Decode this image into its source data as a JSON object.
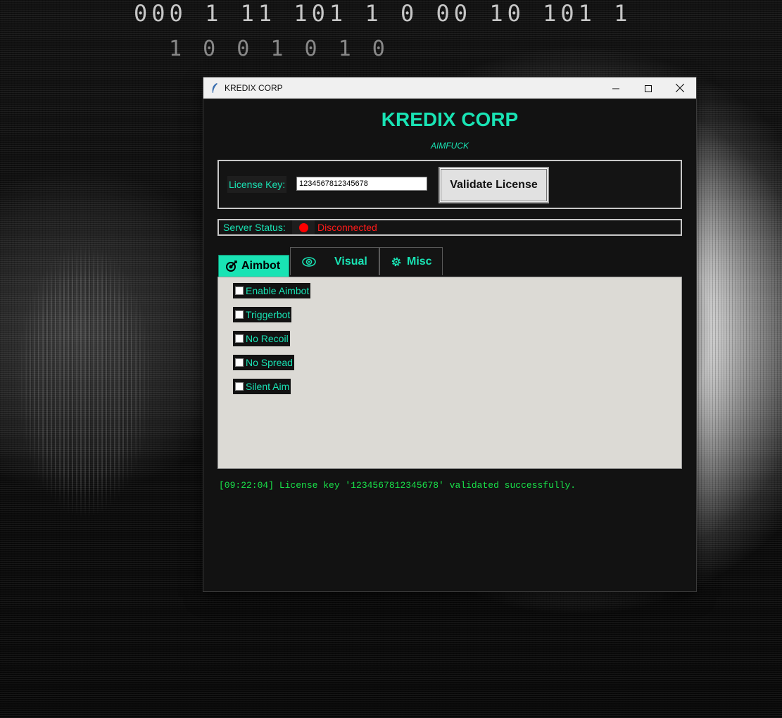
{
  "desktop": {
    "binary_rows": [
      "000 1 11  101  1  0 00 10 101   1",
      "1    0 0         1  0       1 0"
    ]
  },
  "window": {
    "title": "KREDIX CORP",
    "controls": {
      "minimize_icon": "minimize-icon",
      "maximize_icon": "maximize-icon",
      "close_icon": "close-icon"
    }
  },
  "header": {
    "title": "KREDIX CORP",
    "subtitle": "AIMFUCK"
  },
  "license": {
    "label": "License Key:",
    "value": "1234567812345678",
    "validate_label": "Validate License"
  },
  "server": {
    "label": "Server Status:",
    "status_text": "Disconnected",
    "status_color": "#ff0000"
  },
  "tabs": [
    {
      "label": "Aimbot",
      "icon": "target-icon",
      "active": true
    },
    {
      "label": "Visual",
      "icon": "eye-icon",
      "active": false
    },
    {
      "label": "Misc",
      "icon": "gear-icon",
      "active": false
    }
  ],
  "aimbot_options": [
    {
      "label": "Enable Aimbot",
      "checked": false
    },
    {
      "label": "Triggerbot",
      "checked": false
    },
    {
      "label": "No Recoil",
      "checked": false
    },
    {
      "label": "No Spread",
      "checked": false
    },
    {
      "label": "Silent Aim",
      "checked": false
    }
  ],
  "log": {
    "lines": [
      "[09:22:04] License key '1234567812345678' validated successfully."
    ]
  },
  "colors": {
    "accent": "#19e3b4",
    "log_text": "#19e34a",
    "panel_bg": "#dcdad5",
    "window_bg": "#121212"
  }
}
